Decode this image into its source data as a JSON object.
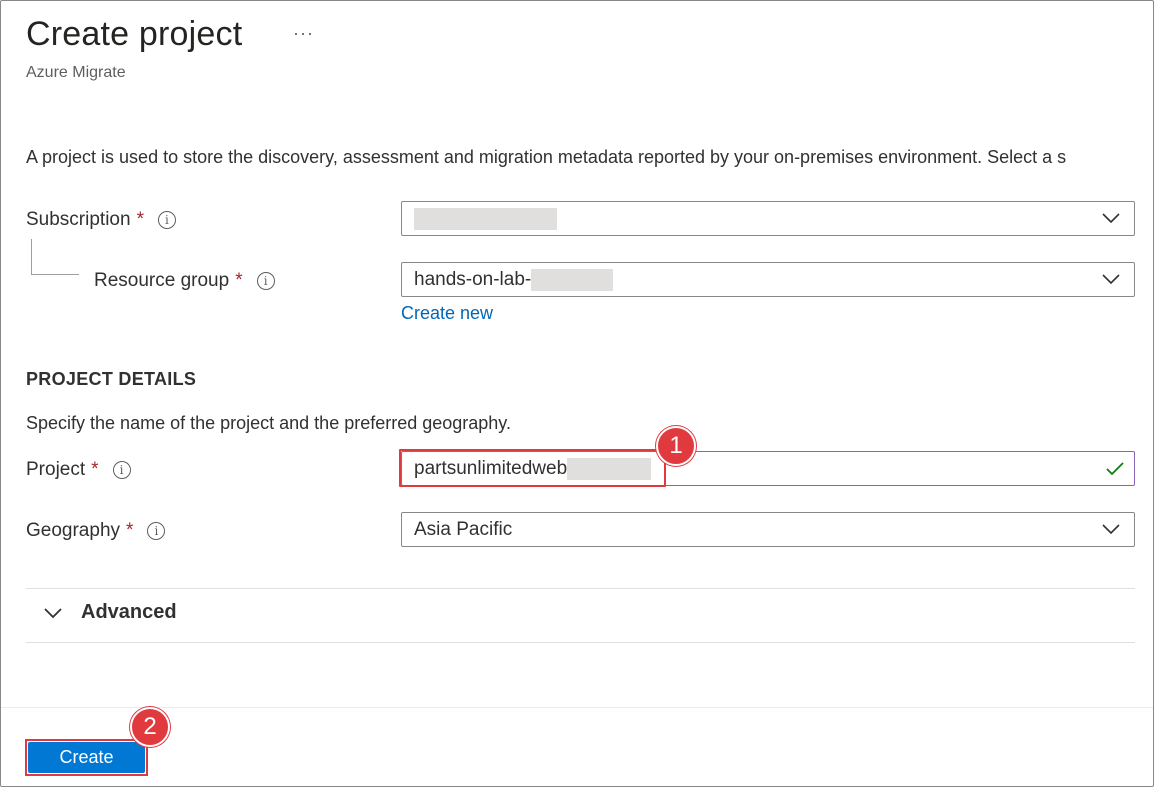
{
  "header": {
    "title": "Create project",
    "more_label": "···",
    "subtitle": "Azure Migrate"
  },
  "description": "A project is used to store the discovery, assessment and migration metadata reported by your on-premises environment. Select a s",
  "subscription": {
    "label": "Subscription",
    "required_mark": "*",
    "value": ""
  },
  "resource_group": {
    "label": "Resource group",
    "required_mark": "*",
    "value": "hands-on-lab-",
    "create_new_label": "Create new"
  },
  "project_details": {
    "heading": "PROJECT DETAILS",
    "hint": "Specify the name of the project and the preferred geography.",
    "project": {
      "label": "Project",
      "required_mark": "*",
      "value": "partsunlimitedweb"
    },
    "geography": {
      "label": "Geography",
      "required_mark": "*",
      "value": "Asia Pacific"
    }
  },
  "advanced": {
    "label": "Advanced"
  },
  "footer": {
    "create_label": "Create"
  },
  "annotations": {
    "step1": "1",
    "step2": "2"
  },
  "colors": {
    "accent": "#0078d4",
    "link": "#0067b8",
    "required": "#a4262c",
    "annotation": "#e0393e",
    "valid_check": "#107c10",
    "focus_border": "#8764b8"
  }
}
